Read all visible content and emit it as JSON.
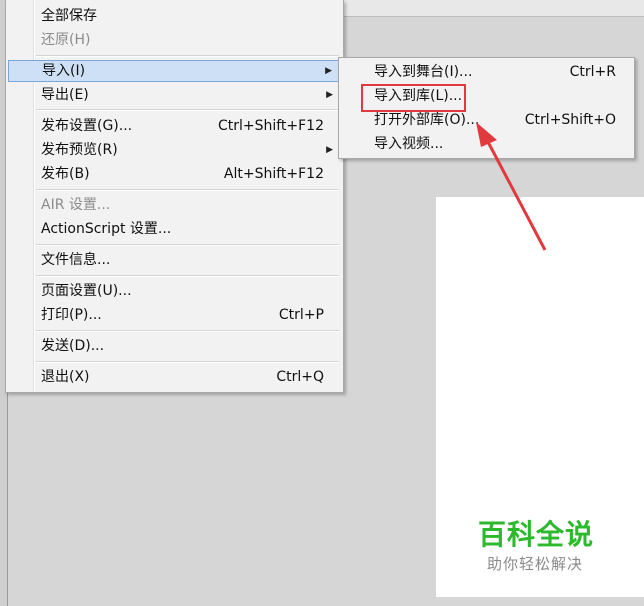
{
  "file_menu": {
    "items": [
      {
        "label": "全部保存",
        "shortcut": "",
        "disabled": false
      },
      {
        "label": "还原(H)",
        "shortcut": "",
        "disabled": true
      },
      {
        "label": "导入(I)",
        "shortcut": "",
        "disabled": false,
        "submenu": true,
        "highlighted": true
      },
      {
        "label": "导出(E)",
        "shortcut": "",
        "disabled": false,
        "submenu": true
      },
      {
        "label": "发布设置(G)...",
        "shortcut": "Ctrl+Shift+F12",
        "disabled": false
      },
      {
        "label": "发布预览(R)",
        "shortcut": "",
        "disabled": false,
        "submenu": true
      },
      {
        "label": "发布(B)",
        "shortcut": "Alt+Shift+F12",
        "disabled": false
      },
      {
        "label": "AIR 设置...",
        "shortcut": "",
        "disabled": true
      },
      {
        "label": "ActionScript 设置...",
        "shortcut": "",
        "disabled": false
      },
      {
        "label": "文件信息...",
        "shortcut": "",
        "disabled": false
      },
      {
        "label": "页面设置(U)...",
        "shortcut": "",
        "disabled": false
      },
      {
        "label": "打印(P)...",
        "shortcut": "Ctrl+P",
        "disabled": false
      },
      {
        "label": "发送(D)...",
        "shortcut": "",
        "disabled": false
      },
      {
        "label": "退出(X)",
        "shortcut": "Ctrl+Q",
        "disabled": false
      }
    ]
  },
  "import_submenu": {
    "items": [
      {
        "label": "导入到舞台(I)...",
        "shortcut": "Ctrl+R"
      },
      {
        "label": "导入到库(L)...",
        "shortcut": "",
        "annotated": true
      },
      {
        "label": "打开外部库(O)...",
        "shortcut": "Ctrl+Shift+O"
      },
      {
        "label": "导入视频...",
        "shortcut": ""
      }
    ]
  },
  "watermark": {
    "title": "百科全说",
    "subtitle": "助你轻松解决"
  },
  "colors": {
    "highlight_bg": "#cde0f5",
    "annotation_red": "#e03a3e",
    "watermark_green": "#2eb82e"
  }
}
